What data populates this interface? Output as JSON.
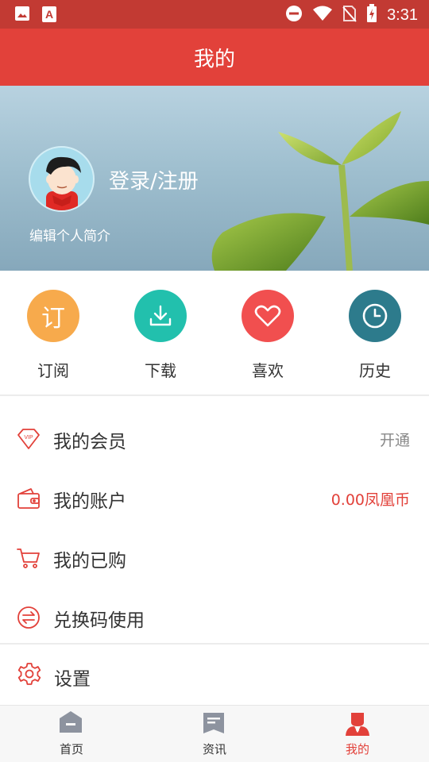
{
  "status_bar": {
    "time": "3:31",
    "left_icons": [
      "image-icon",
      "text-app-icon"
    ],
    "right_icons": [
      "do-not-disturb-icon",
      "wifi-icon",
      "no-sim-icon",
      "battery-charging-icon"
    ]
  },
  "header": {
    "title": "我的"
  },
  "profile": {
    "login_label": "登录/注册",
    "intro_label": "编辑个人简介"
  },
  "quick_actions": [
    {
      "label": "订阅",
      "icon": "subscribe-icon",
      "icon_char": "订",
      "color": "#f7aa4c"
    },
    {
      "label": "下载",
      "icon": "download-icon",
      "color": "#22c0ad"
    },
    {
      "label": "喜欢",
      "icon": "heart-icon",
      "color": "#f14f4f"
    },
    {
      "label": "历史",
      "icon": "clock-icon",
      "color": "#2d7b8c"
    }
  ],
  "menu": [
    {
      "label": "我的会员",
      "icon": "vip-diamond-icon",
      "right": "开通"
    },
    {
      "label": "我的账户",
      "icon": "wallet-icon",
      "right": "0.00凤凰币"
    },
    {
      "label": "我的已购",
      "icon": "cart-icon",
      "right": ""
    },
    {
      "label": "兑换码使用",
      "icon": "exchange-icon",
      "right": ""
    }
  ],
  "settings": {
    "label": "设置",
    "icon": "gear-icon"
  },
  "tab_bar": [
    {
      "label": "首页",
      "icon": "home-icon",
      "active": false
    },
    {
      "label": "资讯",
      "icon": "news-icon",
      "active": false
    },
    {
      "label": "我的",
      "icon": "profile-icon",
      "active": true
    }
  ],
  "colors": {
    "accent": "#e2413a",
    "status_bar": "#c23a33"
  }
}
